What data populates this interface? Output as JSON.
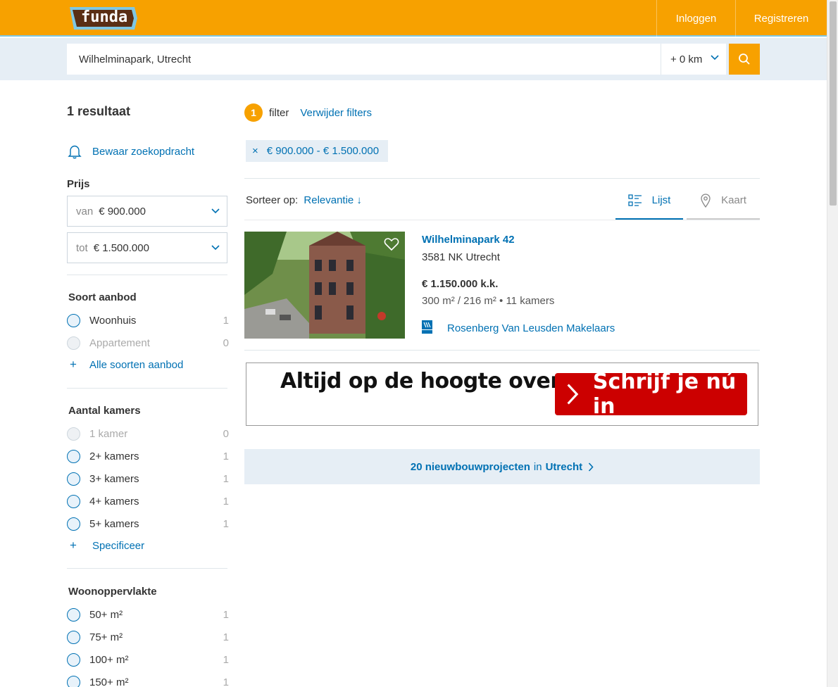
{
  "header": {
    "logo_text": "funda",
    "login": "Inloggen",
    "register": "Registreren"
  },
  "search": {
    "value": "Wilhelminapark, Utrecht",
    "radius": "+ 0 km"
  },
  "sidebar": {
    "result_count": "1 resultaat",
    "save_search": "Bewaar zoekopdracht",
    "price": {
      "title": "Prijs",
      "from_prefix": "van",
      "from_value": "€ 900.000",
      "to_prefix": "tot",
      "to_value": "€ 1.500.000"
    },
    "soort": {
      "title": "Soort aanbod",
      "options": [
        {
          "label": "Woonhuis",
          "count": "1"
        },
        {
          "label": "Appartement",
          "count": "0"
        }
      ],
      "more": "Alle soorten aanbod"
    },
    "kamers": {
      "title": "Aantal kamers",
      "options": [
        {
          "label": "1 kamer",
          "count": "0"
        },
        {
          "label": "2+ kamers",
          "count": "1"
        },
        {
          "label": "3+ kamers",
          "count": "1"
        },
        {
          "label": "4+ kamers",
          "count": "1"
        },
        {
          "label": "5+ kamers",
          "count": "1"
        }
      ],
      "more": "Specificeer"
    },
    "oppervlakte": {
      "title": "Woonoppervlakte",
      "options": [
        {
          "label": "50+ m²",
          "count": "1"
        },
        {
          "label": "75+ m²",
          "count": "1"
        },
        {
          "label": "100+ m²",
          "count": "1"
        },
        {
          "label": "150+ m²",
          "count": "1"
        }
      ]
    }
  },
  "filters": {
    "count": "1",
    "label": "filter",
    "clear": "Verwijder filters",
    "chip": "€ 900.000 - € 1.500.000"
  },
  "sort": {
    "label": "Sorteer op:",
    "value": "Relevantie ↓"
  },
  "view": {
    "list": "Lijst",
    "map": "Kaart"
  },
  "listing": {
    "title": "Wilhelminapark 42",
    "address": "3581 NK Utrecht",
    "price": "€ 1.150.000 k.k.",
    "specs": "300 m² / 216 m² • 11 kamers",
    "agent": "Rosenberg Van Leusden Makelaars"
  },
  "ad": {
    "text": "Altijd op de hoogte over",
    "button": "Schrijf je nú in"
  },
  "nieuwbouw": {
    "count_text": "20 nieuwbouwprojecten",
    "in": "in",
    "city": "Utrecht"
  },
  "colors": {
    "brand": "#f7a100",
    "link": "#0071b3",
    "ad_button": "#cc0000"
  }
}
